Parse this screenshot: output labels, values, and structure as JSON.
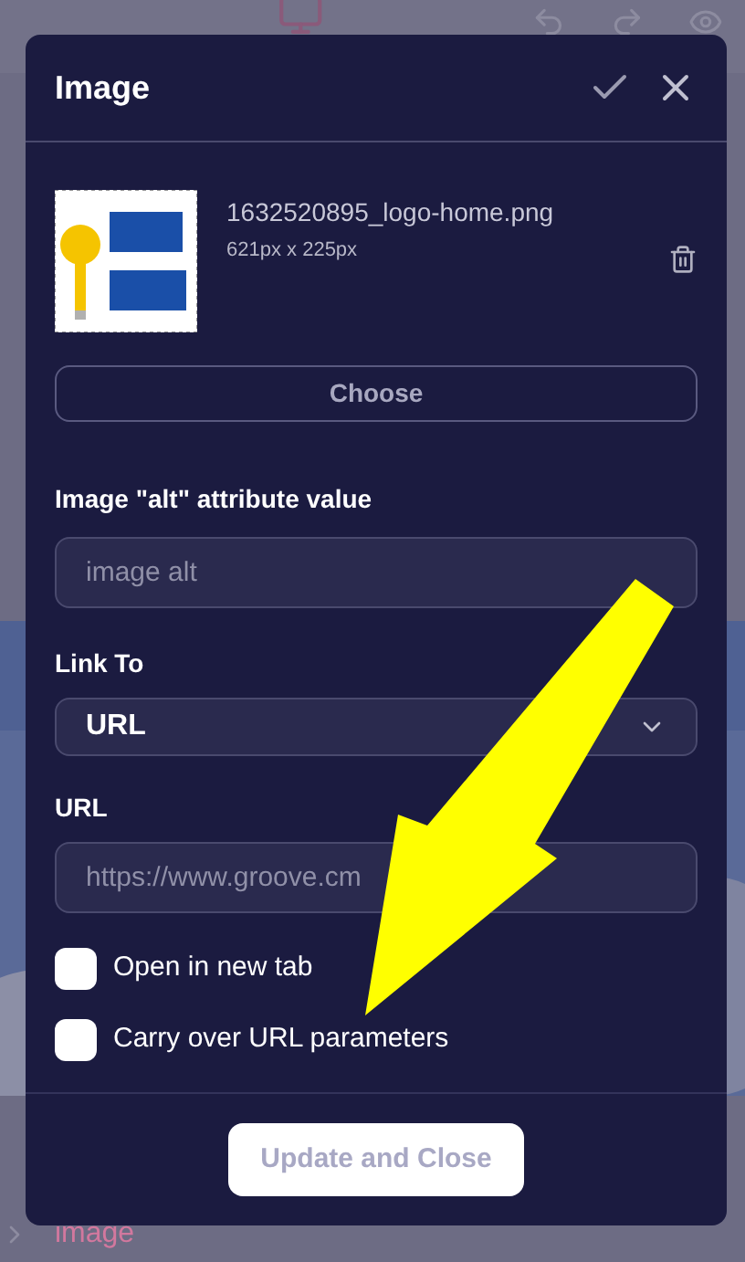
{
  "background": {
    "breadcrumb": "image"
  },
  "dialog": {
    "title": "Image",
    "file": {
      "name": "1632520895_logo-home.png",
      "size": "621px x 225px"
    },
    "choose_button": "Choose",
    "alt_field": {
      "label": "Image \"alt\" attribute value",
      "placeholder": "image alt"
    },
    "link_to": {
      "label": "Link To",
      "value": "URL"
    },
    "url_field": {
      "label": "URL",
      "placeholder": "https://www.groove.cm"
    },
    "options": [
      {
        "label": "Open in new tab",
        "checked": false
      },
      {
        "label": "Carry over URL parameters",
        "checked": false
      }
    ],
    "submit_button": "Update and Close"
  }
}
